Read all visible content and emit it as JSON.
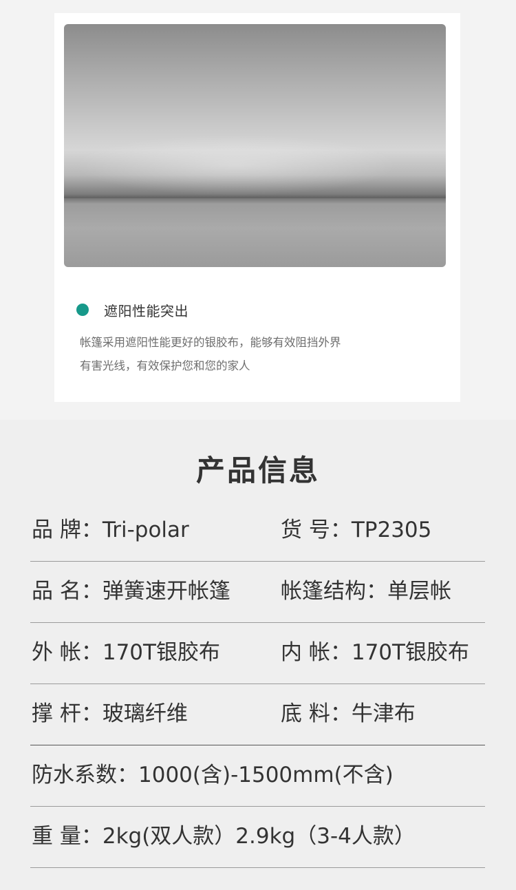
{
  "feature": {
    "title": "遮阳性能突出",
    "desc_line1": "帐篷采用遮阳性能更好的银胶布，能够有效阻挡外界",
    "desc_line2": "有害光线，有效保护您和您的家人",
    "bullet_color": "#17998a"
  },
  "info": {
    "title": "产品信息",
    "rows": [
      {
        "left": "品 牌：Tri-polar",
        "right": "货 号：TP2305"
      },
      {
        "left": "品 名：弹簧速开帐篷",
        "right": "帐篷结构：单层帐"
      },
      {
        "left": "外 帐：170T银胶布",
        "right": "内 帐：170T银胶布"
      },
      {
        "left": "撑 杆：玻璃纤维",
        "right": "底 料：牛津布"
      },
      {
        "full": "防水系数：1000(含)-1500mm(不含)"
      },
      {
        "full": "重 量：2kg(双人款）2.9kg（3-4人款）"
      }
    ]
  }
}
